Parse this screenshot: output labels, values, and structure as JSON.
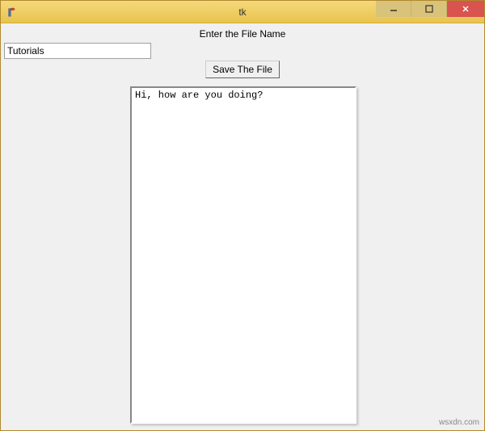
{
  "window": {
    "title": "tk"
  },
  "labels": {
    "enter_file_name": "Enter the File Name"
  },
  "inputs": {
    "filename_value": "Tutorials"
  },
  "buttons": {
    "save_label": "Save The File"
  },
  "textarea": {
    "content": "Hi, how are you doing?"
  },
  "watermark": "wsxdn.com"
}
